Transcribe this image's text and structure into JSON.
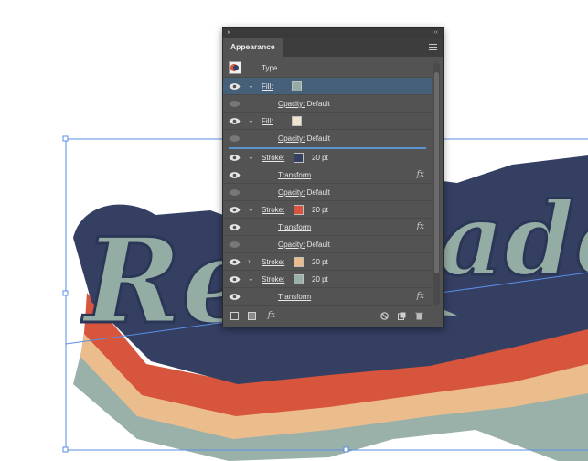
{
  "artwork": {
    "word_left": "Re",
    "word_right": "ade",
    "colors": {
      "navy": "#343f62",
      "mint": "#94ada4",
      "red": "#d6553c",
      "peach": "#ecbd8c",
      "sage": "#9ab1aa",
      "selection": "#5a8ee6"
    }
  },
  "panel": {
    "tab_title": "Appearance",
    "close_glyph": "×",
    "collapse_glyph": "‹‹",
    "header_label": "Type",
    "rows": [
      {
        "label": "Fill:",
        "swatch": "#94ada4",
        "selected": true,
        "chevron": "⌄"
      },
      {
        "label": "Opacity:",
        "value": "Default"
      },
      {
        "label": "Fill:",
        "swatch": "#efe4d2",
        "chevron": "⌄"
      },
      {
        "label": "Opacity:",
        "value": "Default"
      },
      {
        "label": "Stroke:",
        "swatch": "#343f62",
        "value": "20 pt",
        "chevron": "⌄"
      },
      {
        "label": "Transform",
        "fx": "fx"
      },
      {
        "label": "Opacity:",
        "value": "Default"
      },
      {
        "label": "Stroke:",
        "swatch": "#d6553c",
        "value": "20 pt",
        "chevron": "⌄"
      },
      {
        "label": "Transform",
        "fx": "fx"
      },
      {
        "label": "Opacity:",
        "value": "Default"
      },
      {
        "label": "Stroke:",
        "swatch": "#ecbd8c",
        "value": "20 pt",
        "chevron": "›"
      },
      {
        "label": "Stroke:",
        "swatch": "#9ab1aa",
        "value": "20 pt",
        "chevron": "⌄"
      },
      {
        "label": "Transform",
        "fx": "fx"
      }
    ],
    "footer_icons": [
      "add-stroke-icon",
      "add-fill-icon",
      "add-effect-icon",
      "clear-appearance-icon",
      "duplicate-item-icon",
      "delete-item-icon"
    ],
    "fx_label": "fx"
  }
}
